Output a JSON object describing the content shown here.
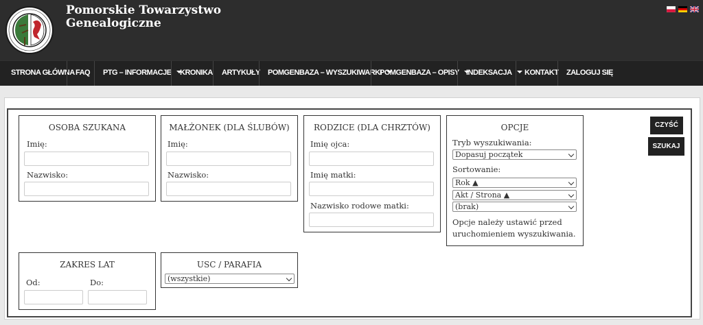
{
  "header": {
    "title_line1": "Pomorskie Towarzystwo",
    "title_line2": "Genealogiczne",
    "logo_text": "POMORSKIE TOWARZYSTWO GENEALOGICZNE",
    "languages": [
      "pl",
      "de",
      "en"
    ]
  },
  "nav": {
    "items": [
      {
        "label": "STRONA GŁÓWNA"
      },
      {
        "label": "FAQ"
      },
      {
        "label": "PTG – INFORMACJE"
      },
      {
        "label": "KRONIKA"
      },
      {
        "label": "ARTYKUŁY"
      },
      {
        "label": "POMGENBAZA – WYSZUKIWARKI"
      },
      {
        "label": "POMGENBAZA – OPISY"
      },
      {
        "label": "INDEKSACJA"
      },
      {
        "label": "KONTAKT"
      },
      {
        "label": "ZALOGUJ SIĘ"
      }
    ]
  },
  "search": {
    "osoba": {
      "title": "OSOBA SZUKANA",
      "imie": "Imię:",
      "nazwisko": "Nazwisko:"
    },
    "malzonek": {
      "title": "MAŁŻONEK (DLA ŚLUBÓW)",
      "imie": "Imię:",
      "nazwisko": "Nazwisko:"
    },
    "rodzice": {
      "title": "RODZICE (DLA CHRZTÓW)",
      "imie_ojca": "Imię ojca:",
      "imie_matki": "Imię matki:",
      "nazwisko_matki": "Nazwisko rodowe matki:"
    },
    "opcje": {
      "title": "OPCJE",
      "tryb_label": "Tryb wyszukiwania:",
      "tryb_value": "Dopasuj początek",
      "sort_label": "Sortowanie:",
      "sort1": "Rok ▲",
      "sort2": "Akt / Strona ▲",
      "sort3": "(brak)",
      "note_line1": "Opcje należy ustawić przed",
      "note_line2": "uruchomieniem wyszukiwania."
    },
    "zakres": {
      "title": "ZAKRES LAT",
      "od": "Od:",
      "do": "Do:"
    },
    "usc": {
      "title": "USC / PARAFIA",
      "value": "(wszystkie)"
    },
    "buttons": {
      "clear": "CZYŚĆ",
      "search": "SZUKAJ"
    }
  }
}
